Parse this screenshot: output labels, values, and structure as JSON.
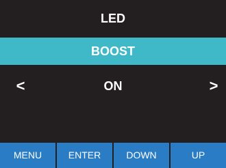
{
  "header": {
    "title": "LED"
  },
  "selected_item": {
    "label": "BOOST"
  },
  "value_row": {
    "value": "ON",
    "left_arrow": "<",
    "right_arrow": ">"
  },
  "softkeys": [
    {
      "label": "MENU"
    },
    {
      "label": "ENTER"
    },
    {
      "label": "DOWN"
    },
    {
      "label": "UP"
    }
  ],
  "colors": {
    "background": "#231f20",
    "highlight": "#3fb8c8",
    "softkey": "#2a7dc4",
    "text": "#ffffff"
  }
}
